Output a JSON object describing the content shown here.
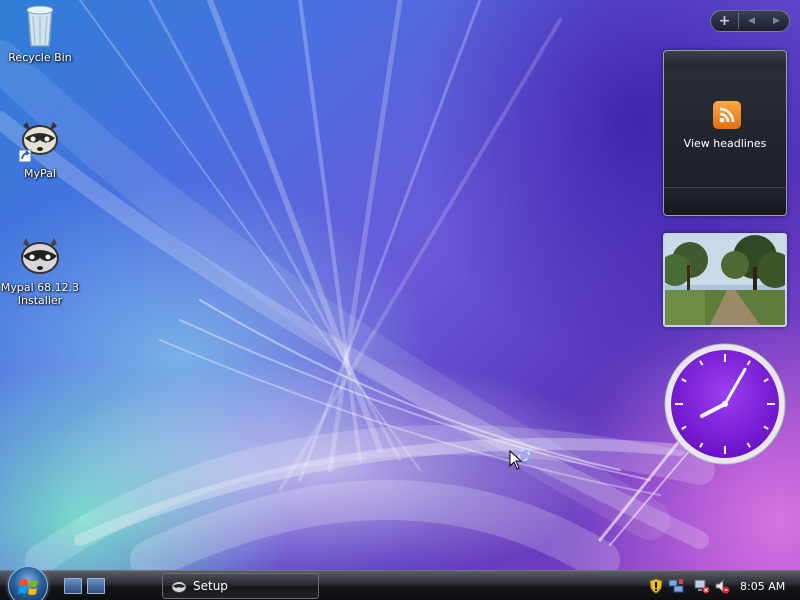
{
  "desktop": {
    "icons": [
      {
        "label": "Recycle Bin",
        "icon": "recycle-bin-icon"
      },
      {
        "label": "MyPal",
        "icon": "raccoon-shortcut-icon"
      },
      {
        "label": "Mypal 68.12.3 Installer",
        "icon": "raccoon-installer-icon"
      }
    ]
  },
  "sidebar": {
    "add_symbol": "+",
    "prev_symbol": "◀",
    "next_symbol": "▶",
    "feeds": {
      "label": "View headlines",
      "icon": "rss-icon"
    },
    "slideshow": {
      "icon": "photo-forest-path"
    },
    "clock": {
      "hour": 8,
      "minute": 5,
      "face_color": "#7a20d8"
    }
  },
  "taskbar": {
    "start_icon": "windows-logo-icon",
    "quick_launch": [
      "show-desktop-icon",
      "switch-windows-icon"
    ],
    "task_button": {
      "label": "Setup",
      "icon": "raccoon-setup-icon"
    },
    "tray_icons": [
      "security-shield-icon",
      "network-icon",
      "network-disconnected-icon",
      "volume-muted-icon"
    ],
    "time": "8:05 AM"
  },
  "colors": {
    "accent": "#7a20d8",
    "taskbar": "#141518"
  }
}
